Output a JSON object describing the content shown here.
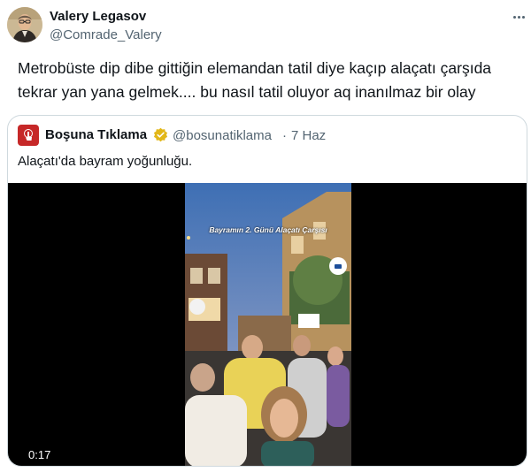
{
  "author": {
    "name": "Valery Legasov",
    "handle": "@Comrade_Valery"
  },
  "tweet": {
    "text": "Metrobüste dip dibe gittiğin elemandan tatil diye kaçıp alaçatı çarşıda tekrar yan yana gelmek.... bu nasıl tatil oluyor aq inanılmaz bir olay"
  },
  "quoted": {
    "name": "Boşuna Tıklama",
    "handle": "@bosunatiklama",
    "separator": "·",
    "time": "7 Haz",
    "text": "Alaçatı'da bayram yoğunluğu.",
    "verified_badge_color": "#e2b719",
    "avatar_color": "#c62828",
    "video": {
      "caption": "Bayramın 2. Günü Alaçatı Çarşısı",
      "duration": "0:17"
    }
  },
  "icons": {
    "more": "more-icon",
    "verified": "verified-badge-icon",
    "brand": "pointer-hand-icon"
  },
  "colors": {
    "text_primary": "#0f1419",
    "text_secondary": "#536471",
    "border": "#cfd9de"
  }
}
